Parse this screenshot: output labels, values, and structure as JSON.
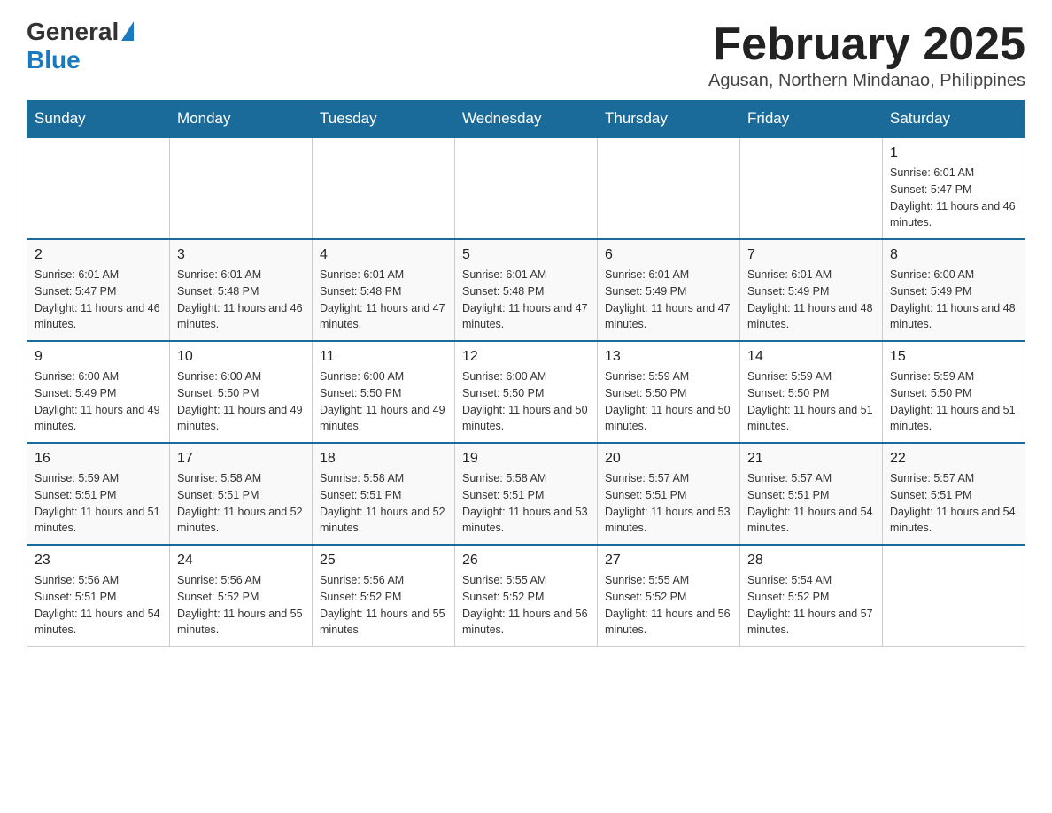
{
  "header": {
    "logo_general": "General",
    "logo_blue": "Blue",
    "title": "February 2025",
    "location": "Agusan, Northern Mindanao, Philippines"
  },
  "days_of_week": [
    "Sunday",
    "Monday",
    "Tuesday",
    "Wednesday",
    "Thursday",
    "Friday",
    "Saturday"
  ],
  "weeks": [
    [
      {
        "day": "",
        "info": ""
      },
      {
        "day": "",
        "info": ""
      },
      {
        "day": "",
        "info": ""
      },
      {
        "day": "",
        "info": ""
      },
      {
        "day": "",
        "info": ""
      },
      {
        "day": "",
        "info": ""
      },
      {
        "day": "1",
        "info": "Sunrise: 6:01 AM\nSunset: 5:47 PM\nDaylight: 11 hours and 46 minutes."
      }
    ],
    [
      {
        "day": "2",
        "info": "Sunrise: 6:01 AM\nSunset: 5:47 PM\nDaylight: 11 hours and 46 minutes."
      },
      {
        "day": "3",
        "info": "Sunrise: 6:01 AM\nSunset: 5:48 PM\nDaylight: 11 hours and 46 minutes."
      },
      {
        "day": "4",
        "info": "Sunrise: 6:01 AM\nSunset: 5:48 PM\nDaylight: 11 hours and 47 minutes."
      },
      {
        "day": "5",
        "info": "Sunrise: 6:01 AM\nSunset: 5:48 PM\nDaylight: 11 hours and 47 minutes."
      },
      {
        "day": "6",
        "info": "Sunrise: 6:01 AM\nSunset: 5:49 PM\nDaylight: 11 hours and 47 minutes."
      },
      {
        "day": "7",
        "info": "Sunrise: 6:01 AM\nSunset: 5:49 PM\nDaylight: 11 hours and 48 minutes."
      },
      {
        "day": "8",
        "info": "Sunrise: 6:00 AM\nSunset: 5:49 PM\nDaylight: 11 hours and 48 minutes."
      }
    ],
    [
      {
        "day": "9",
        "info": "Sunrise: 6:00 AM\nSunset: 5:49 PM\nDaylight: 11 hours and 49 minutes."
      },
      {
        "day": "10",
        "info": "Sunrise: 6:00 AM\nSunset: 5:50 PM\nDaylight: 11 hours and 49 minutes."
      },
      {
        "day": "11",
        "info": "Sunrise: 6:00 AM\nSunset: 5:50 PM\nDaylight: 11 hours and 49 minutes."
      },
      {
        "day": "12",
        "info": "Sunrise: 6:00 AM\nSunset: 5:50 PM\nDaylight: 11 hours and 50 minutes."
      },
      {
        "day": "13",
        "info": "Sunrise: 5:59 AM\nSunset: 5:50 PM\nDaylight: 11 hours and 50 minutes."
      },
      {
        "day": "14",
        "info": "Sunrise: 5:59 AM\nSunset: 5:50 PM\nDaylight: 11 hours and 51 minutes."
      },
      {
        "day": "15",
        "info": "Sunrise: 5:59 AM\nSunset: 5:50 PM\nDaylight: 11 hours and 51 minutes."
      }
    ],
    [
      {
        "day": "16",
        "info": "Sunrise: 5:59 AM\nSunset: 5:51 PM\nDaylight: 11 hours and 51 minutes."
      },
      {
        "day": "17",
        "info": "Sunrise: 5:58 AM\nSunset: 5:51 PM\nDaylight: 11 hours and 52 minutes."
      },
      {
        "day": "18",
        "info": "Sunrise: 5:58 AM\nSunset: 5:51 PM\nDaylight: 11 hours and 52 minutes."
      },
      {
        "day": "19",
        "info": "Sunrise: 5:58 AM\nSunset: 5:51 PM\nDaylight: 11 hours and 53 minutes."
      },
      {
        "day": "20",
        "info": "Sunrise: 5:57 AM\nSunset: 5:51 PM\nDaylight: 11 hours and 53 minutes."
      },
      {
        "day": "21",
        "info": "Sunrise: 5:57 AM\nSunset: 5:51 PM\nDaylight: 11 hours and 54 minutes."
      },
      {
        "day": "22",
        "info": "Sunrise: 5:57 AM\nSunset: 5:51 PM\nDaylight: 11 hours and 54 minutes."
      }
    ],
    [
      {
        "day": "23",
        "info": "Sunrise: 5:56 AM\nSunset: 5:51 PM\nDaylight: 11 hours and 54 minutes."
      },
      {
        "day": "24",
        "info": "Sunrise: 5:56 AM\nSunset: 5:52 PM\nDaylight: 11 hours and 55 minutes."
      },
      {
        "day": "25",
        "info": "Sunrise: 5:56 AM\nSunset: 5:52 PM\nDaylight: 11 hours and 55 minutes."
      },
      {
        "day": "26",
        "info": "Sunrise: 5:55 AM\nSunset: 5:52 PM\nDaylight: 11 hours and 56 minutes."
      },
      {
        "day": "27",
        "info": "Sunrise: 5:55 AM\nSunset: 5:52 PM\nDaylight: 11 hours and 56 minutes."
      },
      {
        "day": "28",
        "info": "Sunrise: 5:54 AM\nSunset: 5:52 PM\nDaylight: 11 hours and 57 minutes."
      },
      {
        "day": "",
        "info": ""
      }
    ]
  ]
}
